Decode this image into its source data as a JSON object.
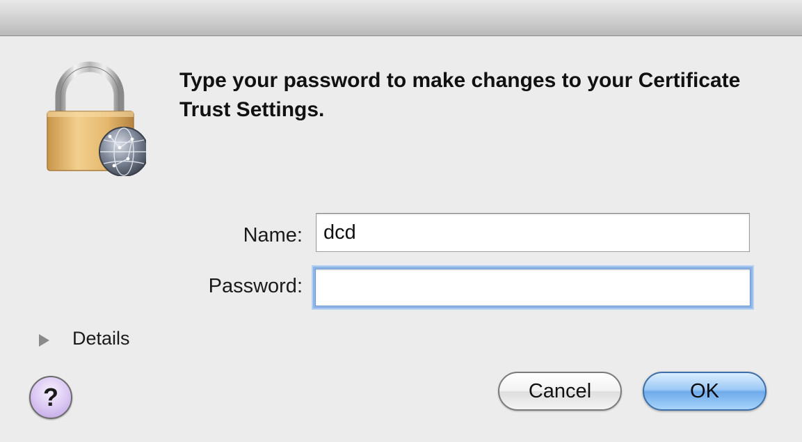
{
  "dialog": {
    "message": "Type your password to make changes to your Certificate Trust Settings.",
    "icon": "lock-with-network-globe-icon"
  },
  "form": {
    "name_label": "Name:",
    "name_value": "dcd",
    "password_label": "Password:",
    "password_value": ""
  },
  "details": {
    "label": "Details",
    "icon": "disclosure-triangle-icon",
    "expanded": false
  },
  "buttons": {
    "help_label": "?",
    "cancel_label": "Cancel",
    "ok_label": "OK"
  },
  "colors": {
    "window_background": "#ececec",
    "default_button": "#6eaaea",
    "focus_ring": "#8fb5e8",
    "help_button": "#d9c6f2",
    "lock_body": "#e2b466"
  }
}
